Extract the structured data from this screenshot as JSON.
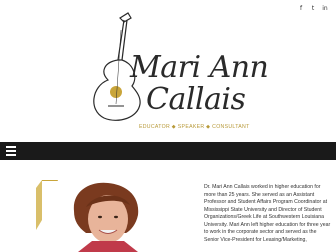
{
  "social": {
    "icons": [
      "facebook-icon",
      "twitter-icon",
      "linkedin-icon"
    ],
    "glyphs": [
      "f",
      "t",
      "in"
    ]
  },
  "brand": {
    "line1": "Mari Ann",
    "line2": "Callais",
    "tagline": "EDUCATOR ◆ SPEAKER ◆ CONSULTANT"
  },
  "colors": {
    "gold": "#c9a53a",
    "nav_bg": "#1a1a1a",
    "text": "#2a2a2a"
  },
  "bio": {
    "text": "Dr. Mari Ann Callais worked in higher education for more than 25 years. She served as an Assistant Professor and Student Affairs Program Coordinator at Mississippi State University and Director of Student Organizations/Greek Life at Southwestern Louisiana University. Mari Ann left higher education for three year to work in the corporate sector and served as the Senior Vice-President for Leasing/Marketing,"
  }
}
